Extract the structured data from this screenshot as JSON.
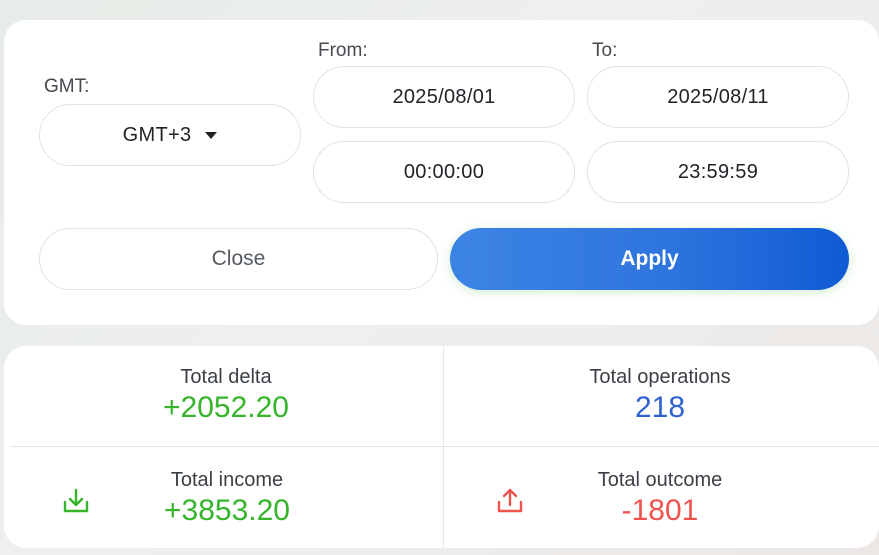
{
  "filter": {
    "gmt_label": "GMT:",
    "gmt_value": "GMT+3",
    "from_label": "From:",
    "to_label": "To:",
    "from_date": "2025/08/01",
    "to_date": "2025/08/11",
    "from_time": "00:00:00",
    "to_time": "23:59:59",
    "close_label": "Close",
    "apply_label": "Apply"
  },
  "stats": {
    "total_delta_label": "Total delta",
    "total_delta_value": "+2052.20",
    "total_operations_label": "Total operations",
    "total_operations_value": "218",
    "total_income_label": "Total income",
    "total_income_value": "+3853.20",
    "total_outcome_label": "Total outcome",
    "total_outcome_value": "-1801"
  },
  "icons": {
    "income": "download-icon",
    "outcome": "upload-icon"
  },
  "colors": {
    "positive": "#36b52a",
    "negative": "#f0534d",
    "neutral": "#2f62d1",
    "accent": "#2e74de"
  }
}
